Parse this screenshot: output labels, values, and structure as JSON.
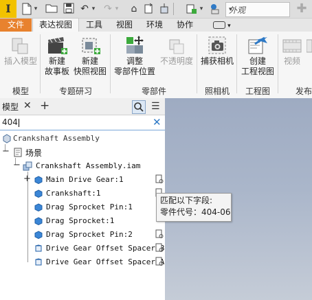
{
  "qat": {
    "app_letter": "I",
    "appearance_value": "外观"
  },
  "tabs": [
    {
      "label": "文件"
    },
    {
      "label": "表达视图"
    },
    {
      "label": "工具"
    },
    {
      "label": "视图"
    },
    {
      "label": "环境"
    },
    {
      "label": "协作"
    }
  ],
  "ribbon": {
    "buttons": {
      "insert_model": [
        "插入模型"
      ],
      "new_storyboard": [
        "新建",
        "故事板"
      ],
      "new_snapshot": [
        "新建",
        "快照视图"
      ],
      "tweak": [
        "调整",
        "零部件位置"
      ],
      "opacity": [
        "不透明度"
      ],
      "capture_camera": [
        "捕获相机"
      ],
      "create_drawing": [
        "创建",
        "工程视图"
      ],
      "video": [
        "视频"
      ]
    },
    "groups": {
      "model": "模型",
      "topic": "专题研习",
      "components": "零部件",
      "camera": "照相机",
      "drawing": "工程图",
      "publish": "发布"
    }
  },
  "browser": {
    "title": "模型",
    "search_value": "404",
    "tree": {
      "root": "Crankshaft Assembly",
      "scene": "场景",
      "assembly": "Crankshaft Assembly.iam",
      "parts": [
        "Main Drive Gear:1",
        "Crankshaft:1",
        "Drag Sprocket Pin:1",
        "Drag Sprocket:1",
        "Drag Sprocket Pin:2",
        "Drive Gear Offset Spacer B",
        "Drive Gear Offset Spacer A"
      ]
    }
  },
  "tooltip": {
    "line1": "匹配以下字段:",
    "line2": "零件代号：404-06"
  },
  "colors": {
    "file_tab": "#e8822e",
    "app_button": "#f2c200",
    "canvas_top": "#9eabc2",
    "canvas_bottom": "#c5ccd7"
  }
}
